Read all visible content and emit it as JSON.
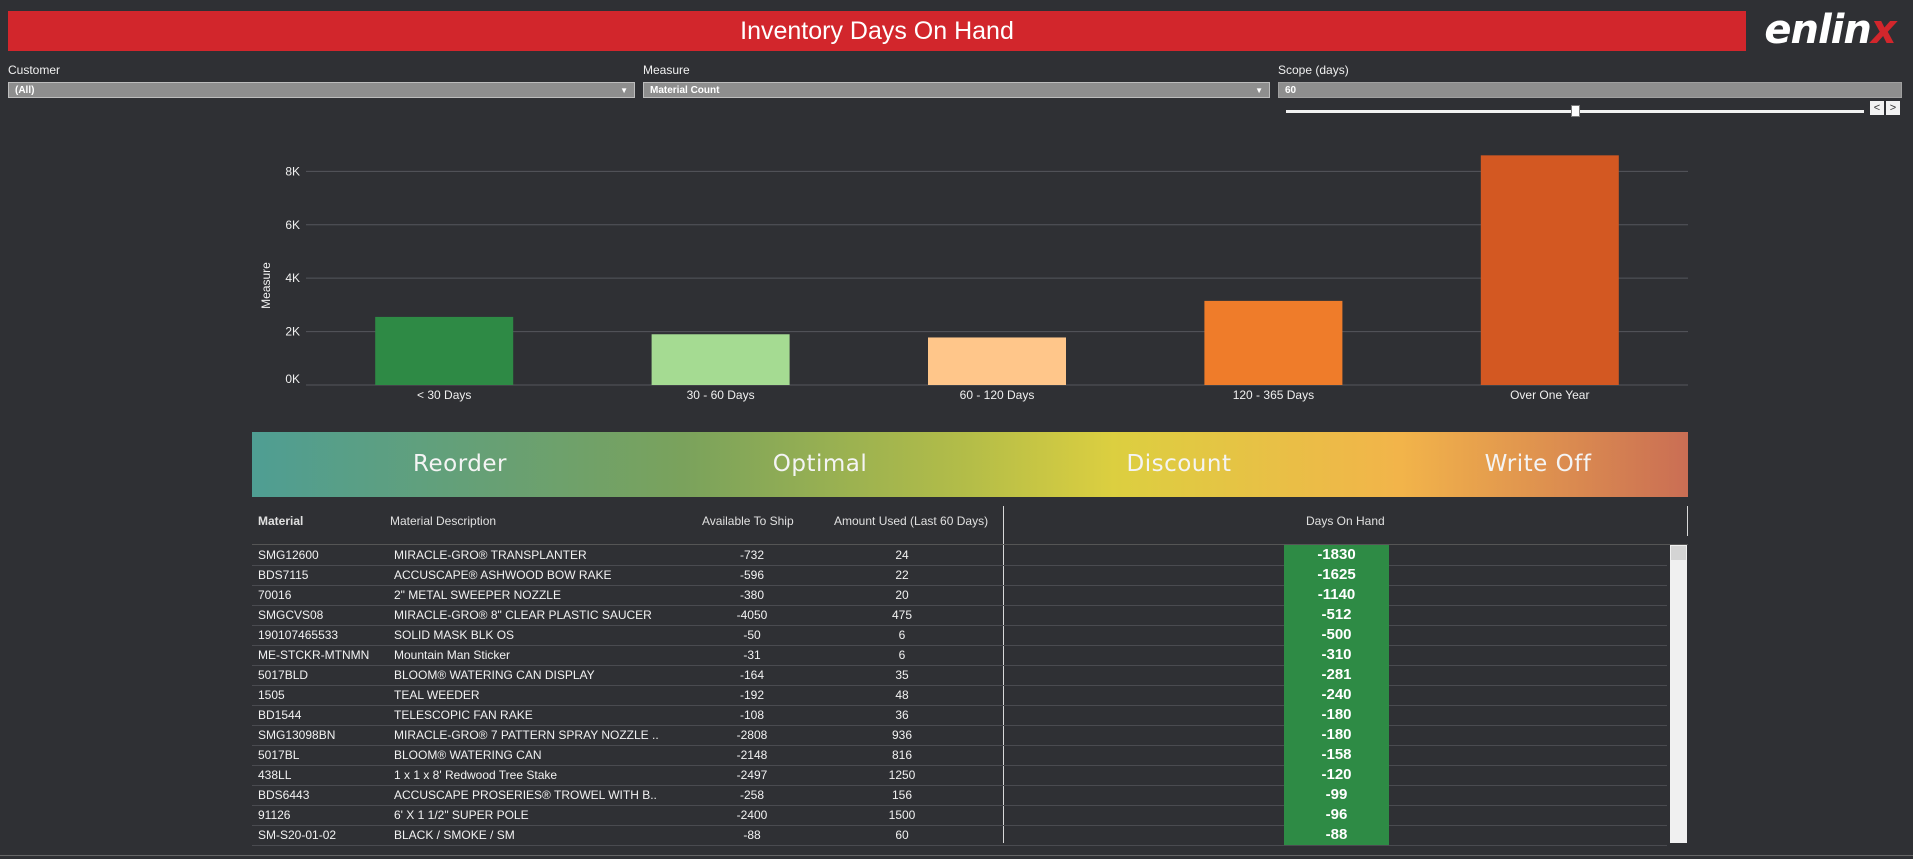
{
  "header": {
    "title": "Inventory Days On Hand"
  },
  "logo": {
    "text_main": "enlin",
    "text_x": "x"
  },
  "filters": {
    "customer": {
      "label": "Customer",
      "value": "(All)"
    },
    "measure": {
      "label": "Measure",
      "value": "Material Count"
    },
    "scope": {
      "label": "Scope (days)",
      "value": "60",
      "prev_symbol": "<",
      "next_symbol": ">"
    }
  },
  "chart_data": {
    "type": "bar",
    "ylabel": "Measure",
    "yticks": [
      "0K",
      "2K",
      "4K",
      "6K",
      "8K"
    ],
    "ylim": [
      0,
      8800
    ],
    "grid": true,
    "categories": [
      "< 30 Days",
      "30 - 60 Days",
      "60 - 120 Days",
      "120 - 365 Days",
      "Over One Year"
    ],
    "values": [
      2550,
      1900,
      1780,
      3150,
      8600
    ],
    "colors": [
      "#2e8a45",
      "#a5db92",
      "#ffc68a",
      "#ef7c2a",
      "#d35822"
    ]
  },
  "band": {
    "labels": [
      "Reorder",
      "Optimal",
      "Discount",
      "Write Off"
    ]
  },
  "table": {
    "headers": {
      "material": "Material",
      "description": "Material Description",
      "available": "Available To Ship",
      "used": "Amount Used (Last 60 Days)",
      "doh": "Days On Hand"
    },
    "rows": [
      {
        "material": "SMG12600",
        "description": "MIRACLE-GRO® TRANSPLANTER",
        "available": "-732",
        "used": "24",
        "doh": "-1830"
      },
      {
        "material": "BDS7115",
        "description": "ACCUSCAPE® ASHWOOD BOW RAKE",
        "available": "-596",
        "used": "22",
        "doh": "-1625"
      },
      {
        "material": "70016",
        "description": "2\" METAL SWEEPER NOZZLE",
        "available": "-380",
        "used": "20",
        "doh": "-1140"
      },
      {
        "material": "SMGCVS08",
        "description": "MIRACLE-GRO® 8\" CLEAR PLASTIC SAUCER",
        "available": "-4050",
        "used": "475",
        "doh": "-512"
      },
      {
        "material": "190107465533",
        "description": "SOLID MASK BLK  OS",
        "available": "-50",
        "used": "6",
        "doh": "-500"
      },
      {
        "material": "ME-STCKR-MTNMN",
        "description": "Mountain Man Sticker",
        "available": "-31",
        "used": "6",
        "doh": "-310"
      },
      {
        "material": "5017BLD",
        "description": "BLOOM® WATERING CAN DISPLAY",
        "available": "-164",
        "used": "35",
        "doh": "-281"
      },
      {
        "material": "1505",
        "description": "TEAL WEEDER",
        "available": "-192",
        "used": "48",
        "doh": "-240"
      },
      {
        "material": "BD1544",
        "description": "TELESCOPIC FAN RAKE",
        "available": "-108",
        "used": "36",
        "doh": "-180"
      },
      {
        "material": "SMG13098BN",
        "description": "MIRACLE-GRO® 7 PATTERN SPRAY NOZZLE ..",
        "available": "-2808",
        "used": "936",
        "doh": "-180"
      },
      {
        "material": "5017BL",
        "description": "BLOOM® WATERING CAN",
        "available": "-2148",
        "used": "816",
        "doh": "-158"
      },
      {
        "material": "438LL",
        "description": "1 x 1 x 8' Redwood Tree Stake",
        "available": "-2497",
        "used": "1250",
        "doh": "-120"
      },
      {
        "material": "BDS6443",
        "description": "ACCUSCAPE PROSERIES® TROWEL WITH B..",
        "available": "-258",
        "used": "156",
        "doh": "-99"
      },
      {
        "material": "91126",
        "description": "6' X 1 1/2\" SUPER POLE",
        "available": "-2400",
        "used": "1500",
        "doh": "-96"
      },
      {
        "material": "SM-S20-01-02",
        "description": "BLACK / SMOKE / SM",
        "available": "-88",
        "used": "60",
        "doh": "-88"
      }
    ]
  }
}
